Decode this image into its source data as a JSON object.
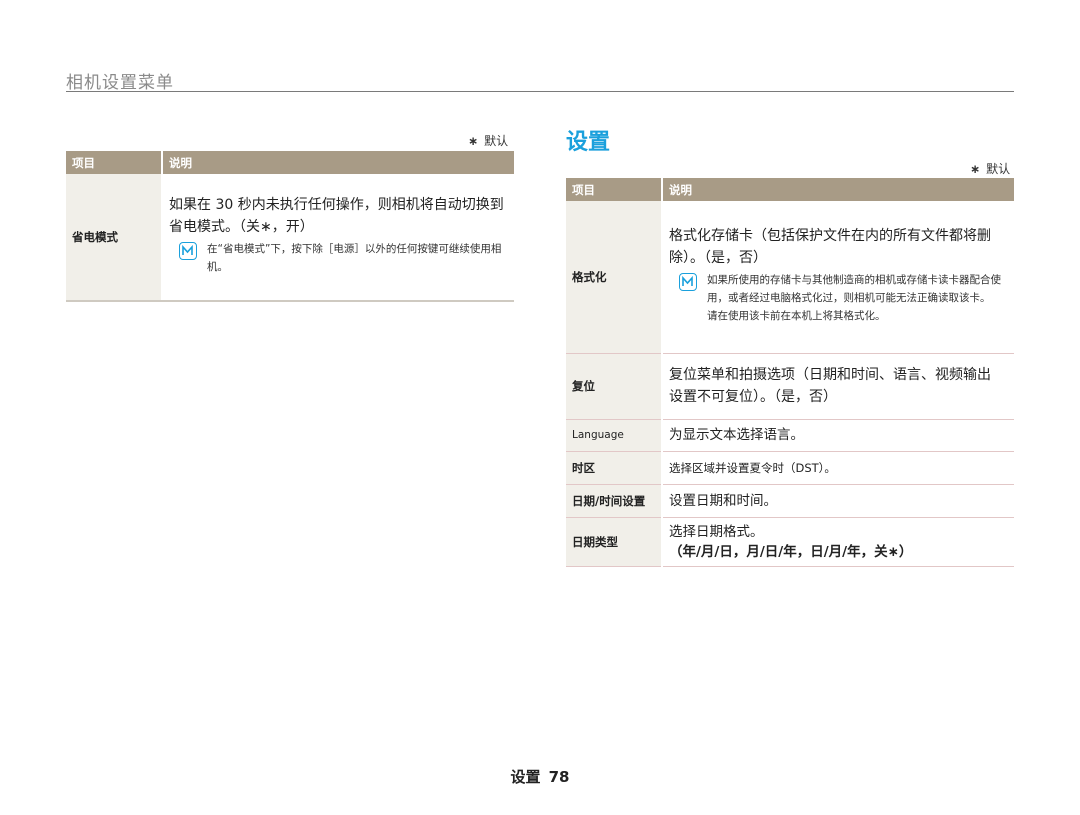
{
  "page_title": "相机设置菜单",
  "left": {
    "legend": {
      "star": "∗",
      "label": "默认"
    },
    "headers": {
      "item": "项目",
      "desc": "说明"
    },
    "rows": [
      {
        "item": "省电模式",
        "desc": "如果在 30 秒内未执行任何操作，则相机将自动切换到省电模式。（关∗，开）",
        "note": "在“省电模式”下，按下除［电源］以外的任何按键可继续使用相机。"
      }
    ]
  },
  "right": {
    "heading": "设置",
    "legend": {
      "star": "∗",
      "label": "默认"
    },
    "headers": {
      "item": "项目",
      "desc": "说明"
    },
    "rows": [
      {
        "item": "格式化",
        "desc": "格式化存储卡（包括保护文件在内的所有文件都将删除）。（是，否）",
        "note": "如果所使用的存储卡与其他制造商的相机或存储卡读卡器配合使用，或者经过电脑格式化过，则相机可能无法正确读取该卡。 请在使用该卡前在本机上将其格式化。"
      },
      {
        "item": "复位",
        "desc": "复位菜单和拍摄选项（日期和时间、语言、视频输出设置不可复位）。（是，否）"
      },
      {
        "item": "Language",
        "desc": "为显示文本选择语言。"
      },
      {
        "item": "时区",
        "desc": "选择区域并设置夏令时（DST）。"
      },
      {
        "item": "日期/时间设置",
        "desc": "设置日期和时间。"
      },
      {
        "item": "日期类型",
        "desc": "选择日期格式。",
        "desc2": "（年/月/日，月/日/年，日/月/年，关∗）"
      }
    ]
  },
  "footer": {
    "section": "设置",
    "page": "78"
  },
  "colors": {
    "header_bg": "#a89b86",
    "item_bg": "#f1efe9",
    "heading": "#1aa0dc",
    "note_icon": "#1aa0dc"
  }
}
